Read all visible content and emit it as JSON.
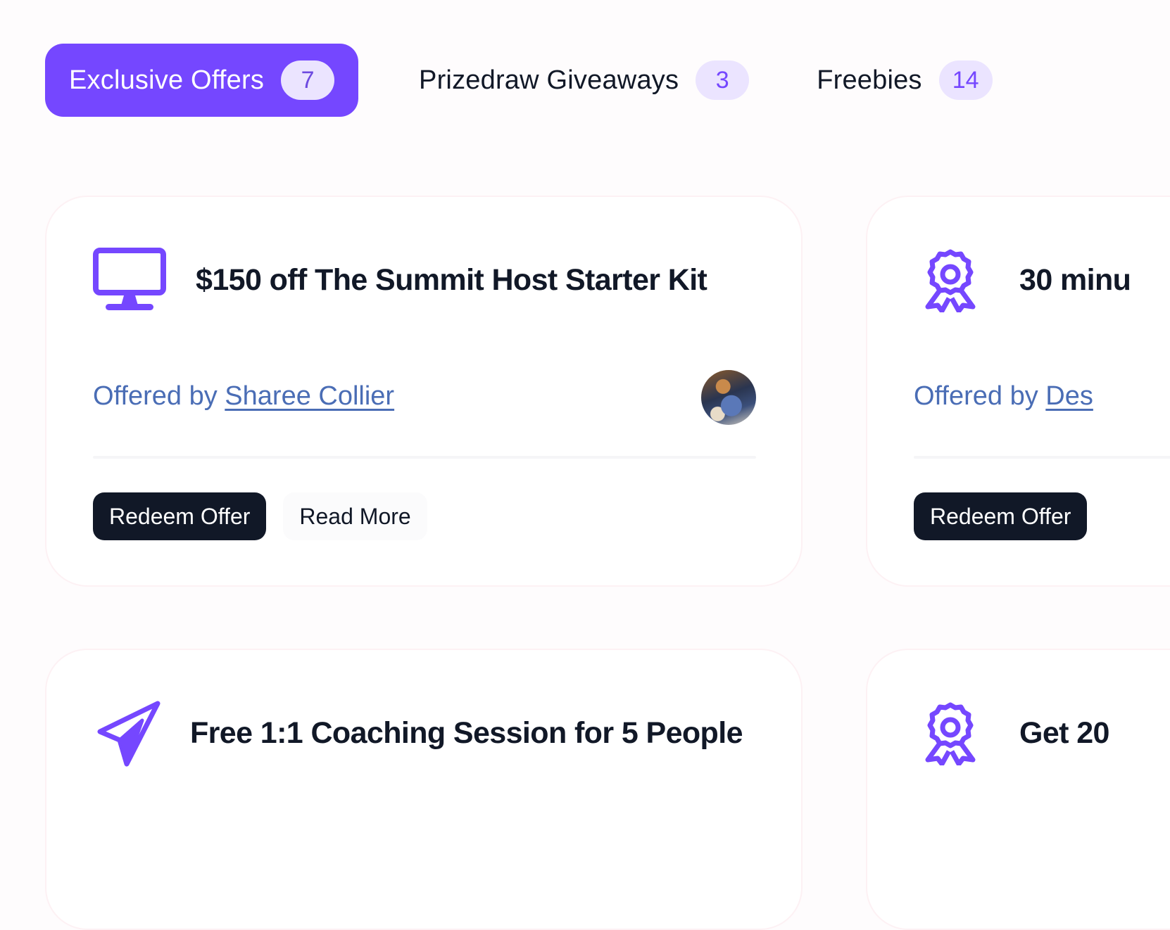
{
  "colors": {
    "accent": "#7547ff",
    "badge_bg": "#ebe4ff",
    "dark_button": "#111827",
    "link": "#4a6db5"
  },
  "tabs": [
    {
      "label": "Exclusive Offers",
      "count": "7",
      "active": true
    },
    {
      "label": "Prizedraw Giveaways",
      "count": "3",
      "active": false
    },
    {
      "label": "Freebies",
      "count": "14",
      "active": false
    }
  ],
  "cards": [
    {
      "icon": "monitor-icon",
      "title": "$150 off The Summit Host Starter Kit",
      "offered_prefix": "Offered by",
      "offered_by": "Sharee Collier",
      "redeem_label": "Redeem Offer",
      "read_more_label": "Read More"
    },
    {
      "icon": "award-ribbon-icon",
      "title": "30 minu",
      "offered_prefix": "Offered by",
      "offered_by": "Des",
      "redeem_label": "Redeem Offer"
    },
    {
      "icon": "paper-plane-icon",
      "title": "Free 1:1 Coaching Session for 5 People"
    },
    {
      "icon": "award-ribbon-icon",
      "title": "Get 20"
    }
  ]
}
